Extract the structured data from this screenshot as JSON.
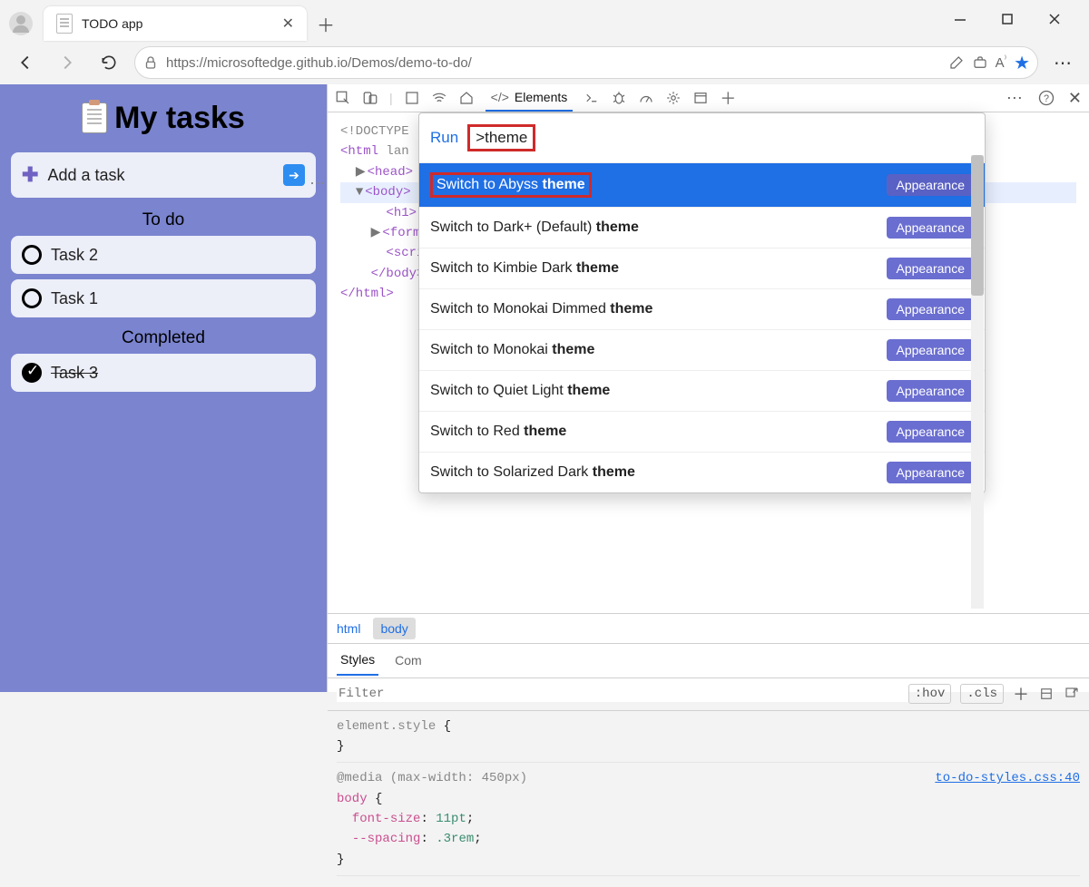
{
  "browser": {
    "tab_title": "TODO app",
    "url": "https://microsoftedge.github.io/Demos/demo-to-do/"
  },
  "app": {
    "title": "My tasks",
    "add_placeholder": "Add a task",
    "sections": {
      "todo": "To do",
      "done": "Completed"
    },
    "todo_tasks": [
      "Task 2",
      "Task 1"
    ],
    "done_tasks": [
      "Task 3"
    ]
  },
  "devtools": {
    "active_panel": "Elements",
    "dom_lines": [
      "<!DOCTYPE",
      "<html lan",
      "  ▶ <head>",
      "  ▼ <body>",
      "      <h1>",
      "    ▶ <form>",
      "      <scrip",
      "    </body>",
      "</html>"
    ],
    "breadcrumb": [
      "html",
      "body"
    ],
    "sub_tabs": [
      "Styles",
      "Com"
    ],
    "filter_placeholder": "Filter",
    "filter_actions": [
      ":hov",
      ".cls"
    ],
    "styles_block1": "element.style {\n}",
    "media_line": "@media (max-width: 450px)",
    "body_selector": "body",
    "body_rules": [
      [
        "font-size",
        "11pt"
      ],
      [
        "--spacing",
        ".3rem"
      ]
    ],
    "styles_link": "to-do-styles.css:40"
  },
  "palette": {
    "run_label": "Run",
    "query": ">theme",
    "badge": "Appearance",
    "items": [
      {
        "prefix": "Switch to Abyss ",
        "match": "theme",
        "selected": true
      },
      {
        "prefix": "Switch to Dark+ (Default) ",
        "match": "theme"
      },
      {
        "prefix": "Switch to Kimbie Dark ",
        "match": "theme"
      },
      {
        "prefix": "Switch to Monokai Dimmed ",
        "match": "theme"
      },
      {
        "prefix": "Switch to Monokai ",
        "match": "theme"
      },
      {
        "prefix": "Switch to Quiet Light ",
        "match": "theme"
      },
      {
        "prefix": "Switch to Red ",
        "match": "theme"
      },
      {
        "prefix": "Switch to Solarized Dark ",
        "match": "theme"
      }
    ]
  }
}
